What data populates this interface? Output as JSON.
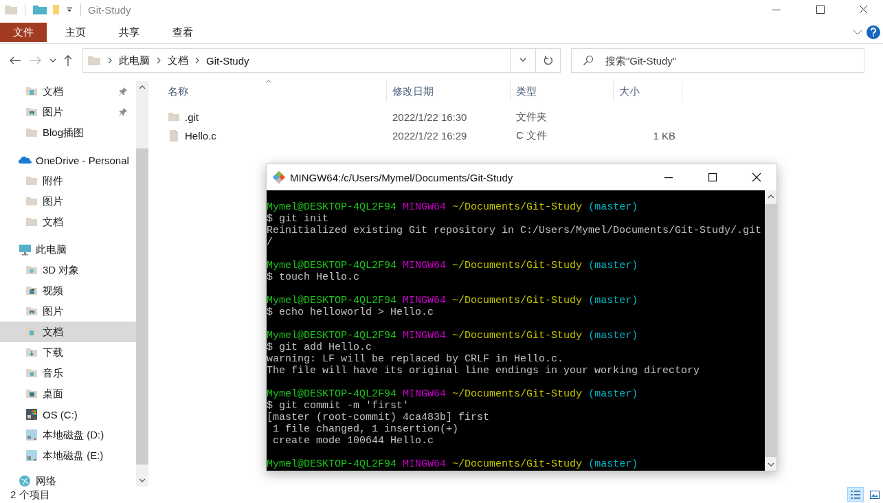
{
  "window": {
    "title": "Git-Study"
  },
  "ribbon": {
    "tabs": [
      {
        "label": "文件",
        "selected": true
      },
      {
        "label": "主页",
        "selected": false
      },
      {
        "label": "共享",
        "selected": false
      },
      {
        "label": "查看",
        "selected": false
      }
    ]
  },
  "address_bar": {
    "crumbs": [
      "此电脑",
      "文档",
      "Git-Study"
    ],
    "search": {
      "placeholder": "搜索\"Git-Study\""
    }
  },
  "sidebar": {
    "sections": [
      {
        "children": [
          {
            "label": "文档",
            "kind": "docs",
            "pinned": true,
            "selected": false
          },
          {
            "label": "图片",
            "kind": "pics",
            "pinned": true,
            "selected": false
          },
          {
            "label": "Blog插图",
            "kind": "folder",
            "pinned": false,
            "selected": false
          }
        ]
      },
      {
        "label": "OneDrive - Personal",
        "kind": "cloud",
        "selected": false,
        "children": [
          {
            "label": "附件",
            "kind": "folder",
            "pinned": false,
            "selected": false
          },
          {
            "label": "图片",
            "kind": "folder",
            "pinned": false,
            "selected": false
          },
          {
            "label": "文档",
            "kind": "folder",
            "pinned": false,
            "selected": false
          }
        ]
      },
      {
        "label": "此电脑",
        "kind": "pc",
        "selected": false,
        "children": [
          {
            "label": "3D 对象",
            "kind": "cube",
            "pinned": false,
            "selected": false
          },
          {
            "label": "视频",
            "kind": "video",
            "pinned": false,
            "selected": false
          },
          {
            "label": "图片",
            "kind": "pics",
            "pinned": false,
            "selected": false
          },
          {
            "label": "文档",
            "kind": "docs",
            "pinned": false,
            "selected": true
          },
          {
            "label": "下载",
            "kind": "download",
            "pinned": false,
            "selected": false
          },
          {
            "label": "音乐",
            "kind": "music",
            "pinned": false,
            "selected": false
          },
          {
            "label": "桌面",
            "kind": "desktop",
            "pinned": false,
            "selected": false
          },
          {
            "label": "OS (C:)",
            "kind": "osdrive",
            "pinned": false,
            "selected": false
          },
          {
            "label": "本地磁盘 (D:)",
            "kind": "drive",
            "pinned": false,
            "selected": false
          },
          {
            "label": "本地磁盘 (E:)",
            "kind": "drive",
            "pinned": false,
            "selected": false
          }
        ]
      },
      {
        "label": "网络",
        "kind": "network",
        "selected": false
      }
    ]
  },
  "table": {
    "columns": [
      "名称",
      "修改日期",
      "类型",
      "大小"
    ],
    "rows": [
      {
        "kind": "folder",
        "name": ".git",
        "modified": "2022/1/22 16:30",
        "type": "文件夹",
        "size": ""
      },
      {
        "kind": "file",
        "name": "Hello.c",
        "modified": "2022/1/22 16:29",
        "type": "C 文件",
        "size": "1 KB"
      }
    ]
  },
  "status_bar": {
    "count": "2 个项目"
  },
  "terminal": {
    "title": "MINGW64:/c/Users/Mymel/Documents/Git-Study",
    "lines": [
      {
        "kind": "prompt",
        "user": "Mymel@DESKTOP-4QL2F94",
        "system": "MINGW64",
        "path": "~/Documents/Git-Study",
        "branch": "(master)"
      },
      {
        "kind": "text",
        "text": "$ git init"
      },
      {
        "kind": "text",
        "text": "Reinitialized existing Git repository in C:/Users/Mymel/Documents/Git-Study/.git"
      },
      {
        "kind": "text",
        "text": "/"
      },
      {
        "kind": "blank"
      },
      {
        "kind": "prompt",
        "user": "Mymel@DESKTOP-4QL2F94",
        "system": "MINGW64",
        "path": "~/Documents/Git-Study",
        "branch": "(master)"
      },
      {
        "kind": "text",
        "text": "$ touch Hello.c"
      },
      {
        "kind": "blank"
      },
      {
        "kind": "prompt",
        "user": "Mymel@DESKTOP-4QL2F94",
        "system": "MINGW64",
        "path": "~/Documents/Git-Study",
        "branch": "(master)"
      },
      {
        "kind": "text",
        "text": "$ echo helloworld > Hello.c"
      },
      {
        "kind": "blank"
      },
      {
        "kind": "prompt",
        "user": "Mymel@DESKTOP-4QL2F94",
        "system": "MINGW64",
        "path": "~/Documents/Git-Study",
        "branch": "(master)"
      },
      {
        "kind": "text",
        "text": "$ git add Hello.c"
      },
      {
        "kind": "text",
        "text": "warning: LF will be replaced by CRLF in Hello.c."
      },
      {
        "kind": "text",
        "text": "The file will have its original line endings in your working directory"
      },
      {
        "kind": "blank"
      },
      {
        "kind": "prompt",
        "user": "Mymel@DESKTOP-4QL2F94",
        "system": "MINGW64",
        "path": "~/Documents/Git-Study",
        "branch": "(master)"
      },
      {
        "kind": "text",
        "text": "$ git commit -m 'first'"
      },
      {
        "kind": "text",
        "text": "[master (root-commit) 4ca483b] first"
      },
      {
        "kind": "text",
        "text": " 1 file changed, 1 insertion(+)"
      },
      {
        "kind": "text",
        "text": " create mode 100644 Hello.c"
      },
      {
        "kind": "blank"
      },
      {
        "kind": "prompt",
        "user": "Mymel@DESKTOP-4QL2F94",
        "system": "MINGW64",
        "path": "~/Documents/Git-Study",
        "branch": "(master)"
      }
    ]
  }
}
